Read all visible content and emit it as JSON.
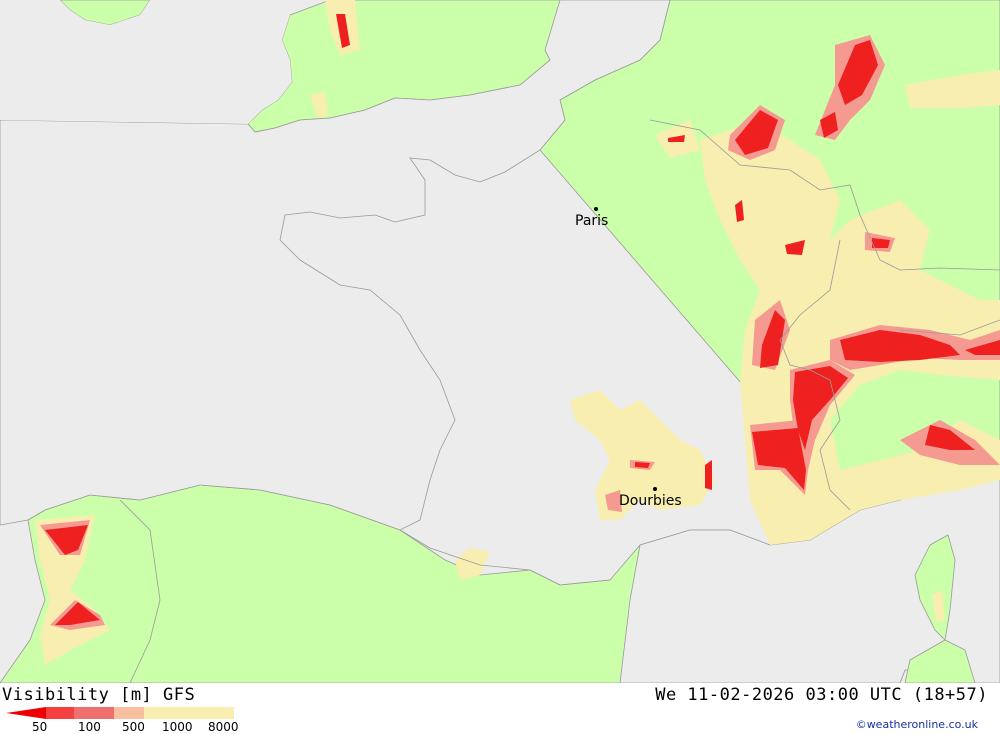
{
  "header": {
    "title": "Visibility [m] GFS",
    "datetime": "We 11-02-2026 03:00 UTC (18+57)"
  },
  "legend": {
    "labels": [
      "50",
      "100",
      "500",
      "1000",
      "8000"
    ],
    "colors": [
      "#ee0000",
      "#f44040",
      "#f07070",
      "#f8c0a0",
      "#f8e8a0",
      "#f8f0b0"
    ]
  },
  "cities": [
    {
      "name": "Paris"
    },
    {
      "name": "Dourbies"
    }
  ],
  "credit": "©weatheronline.co.uk",
  "colors": {
    "sea": "#ececec",
    "land": "#ccffaa",
    "fog_light": "#f8eeb0",
    "fog_medium": "#f59a90",
    "fog_dense": "#ee2020",
    "border": "#999999"
  }
}
